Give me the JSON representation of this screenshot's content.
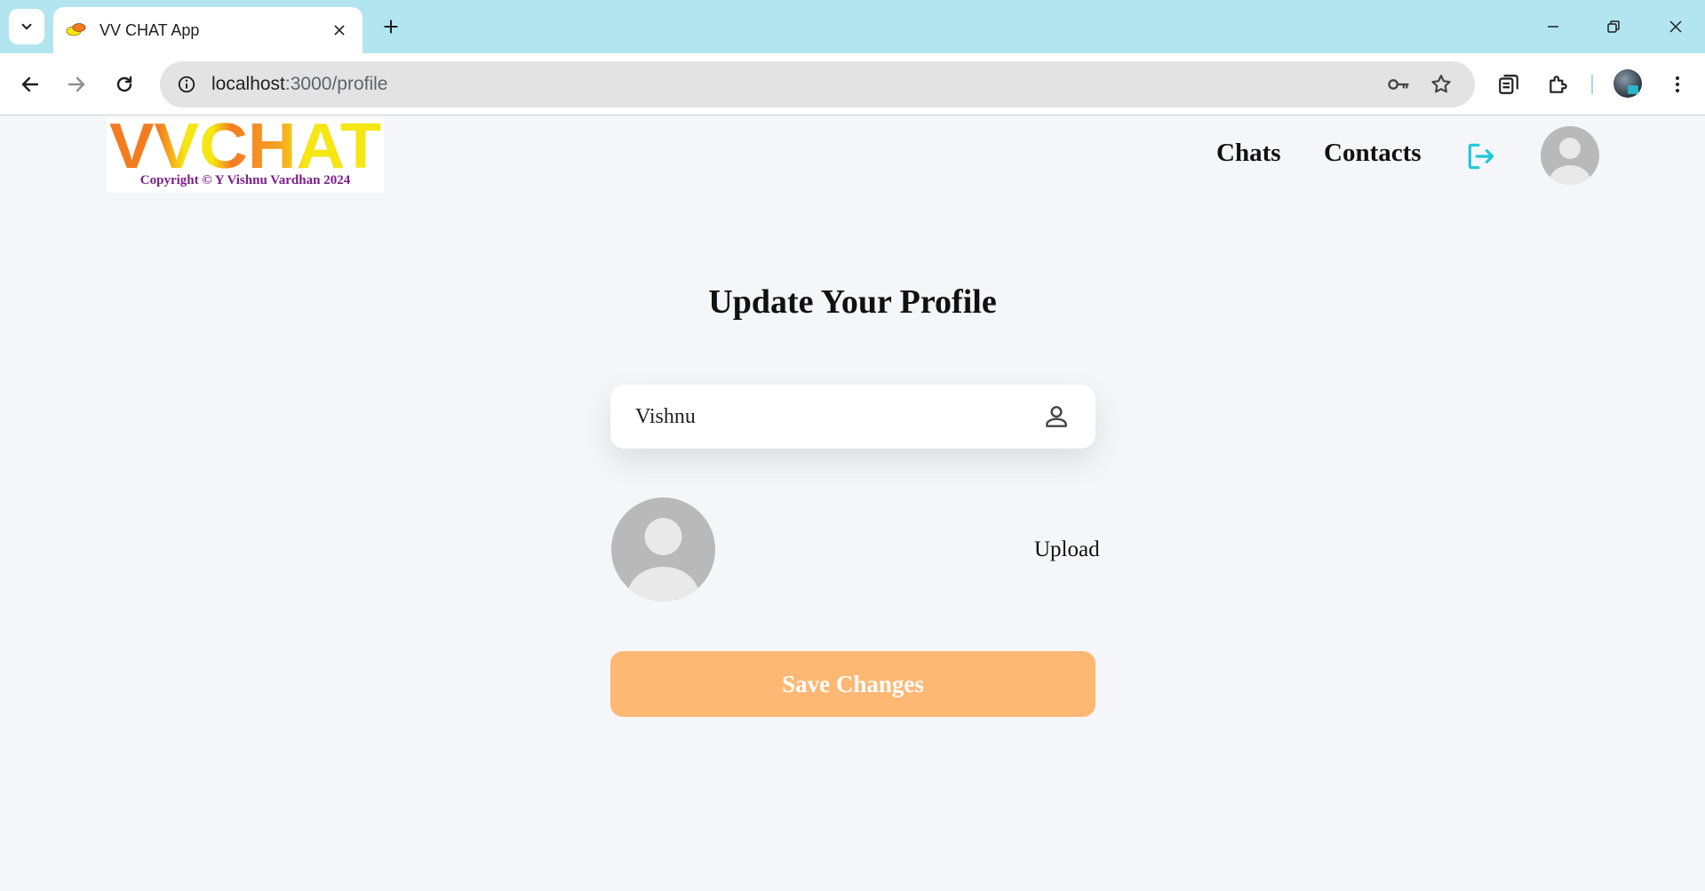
{
  "browser": {
    "tab_title": "VV CHAT App",
    "url_host": "localhost",
    "url_path": ":3000/profile"
  },
  "header": {
    "logo_word": "VVCHAT",
    "logo_copyright": "Copyright © Y Vishnu Vardhan 2024",
    "nav": {
      "chats": "Chats",
      "contacts": "Contacts"
    }
  },
  "main": {
    "title": "Update Your Profile",
    "name_value": "Vishnu",
    "upload_label": "Upload",
    "save_label": "Save Changes"
  },
  "colors": {
    "tabbar_bg": "#b3e5f0",
    "page_bg": "#f5f6fa",
    "logo_orange": "#f47c20",
    "logo_yellow": "#f5e614",
    "logout_accent": "#1ec8d8",
    "save_button": "#fdb874",
    "copyright_purple": "#7a1f8c"
  },
  "icons": {
    "tab_search": "chevron-down-icon",
    "tab_close": "close-icon",
    "new_tab": "plus-icon",
    "back": "arrow-left-icon",
    "forward": "arrow-right-icon",
    "reload": "reload-icon",
    "site_info": "info-icon",
    "password": "key-icon",
    "bookmark": "star-icon",
    "tab_groups": "tab-search-icon",
    "extensions": "puzzle-icon",
    "menu": "kebab-menu-icon",
    "logout": "logout-icon",
    "name_field": "person-icon"
  }
}
